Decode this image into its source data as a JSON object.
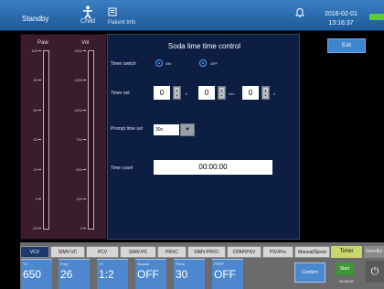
{
  "header": {
    "mode": "Standby",
    "patient_type": "Child",
    "patient_info": "Patient Info",
    "date": "2016-02-01",
    "time": "13:16:37",
    "icons": [
      "child-icon",
      "patient-info-icon",
      "alarm-bell-icon",
      "battery-icon"
    ]
  },
  "meters": {
    "paw_title": "Paw",
    "vol_title": "Vol",
    "paw_ticks": [
      "100",
      "80",
      "60",
      "40",
      "20",
      "0",
      "-20"
    ],
    "vol_ticks": [
      "1500",
      "1250",
      "1000",
      "750",
      "500",
      "250",
      "0"
    ]
  },
  "dialog": {
    "title": "Soda lime time control",
    "timer_switch_label": "Timer switch",
    "on_label": "ON",
    "off_label": "OFF",
    "timer_switch_selected": "ON",
    "timer_set_label": "Timer set",
    "hours": "0",
    "hours_unit": "h",
    "minutes": "0",
    "minutes_unit": "min",
    "seconds": "0",
    "seconds_unit": "s",
    "prompt_label": "Prompt time set",
    "prompt_value": "30s",
    "time_count_label": "Time count",
    "time_count_value": "00:00:00"
  },
  "exit_label": "Exit",
  "tabs": [
    "VCV",
    "SIMV-VC",
    "PCV",
    "SIMV-PC",
    "PRVC",
    "SIMV-PRVC",
    "CPAP/PSV",
    "PSVPro",
    "Manual/Spont"
  ],
  "active_tab": "VCV",
  "params": [
    {
      "label": "TV",
      "value": "650"
    },
    {
      "label": "Freq",
      "value": "26"
    },
    {
      "label": "I:E",
      "value": "1:2"
    },
    {
      "label": "Tpause",
      "value": "OFF"
    },
    {
      "label": "Plimit",
      "value": "30"
    },
    {
      "label": "PEEP",
      "value": "OFF"
    }
  ],
  "confirm_label": "Confirm",
  "timer": {
    "tab": "Timer",
    "start": "Start",
    "value": "00:00:00"
  },
  "standby_tab": "Standby"
}
